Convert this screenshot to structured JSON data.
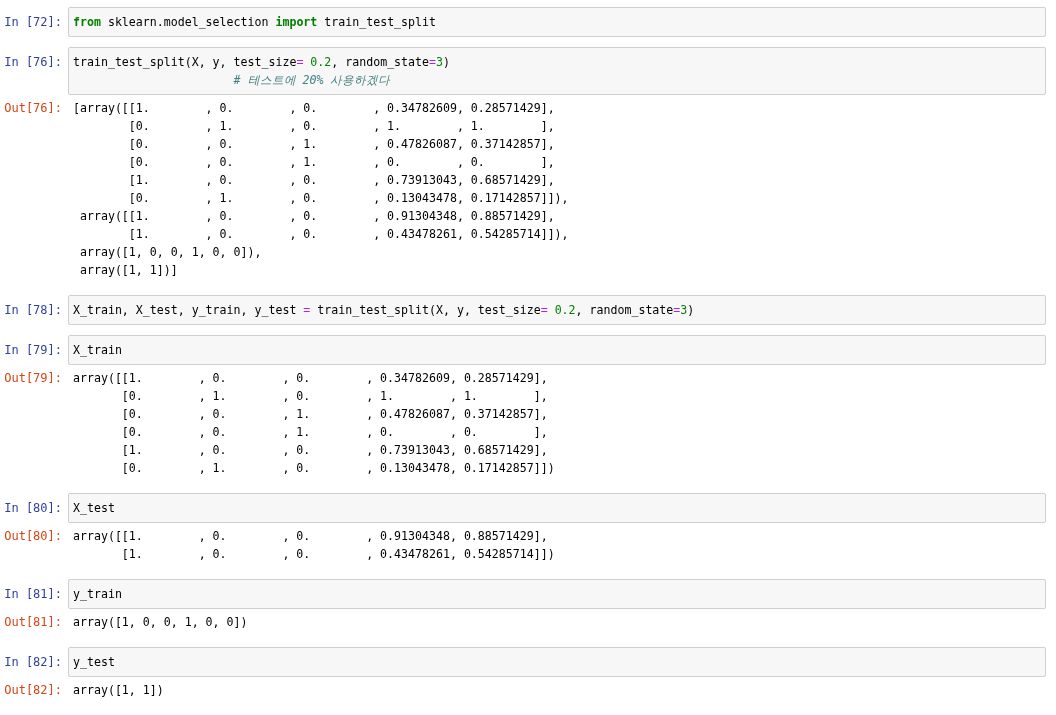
{
  "cells": [
    {
      "input_prompt": "In [72]:",
      "code": [
        [
          {
            "kind": "keyword",
            "text": "from"
          },
          {
            "kind": "name",
            "text": " sklearn.model_selection "
          },
          {
            "kind": "keyword",
            "text": "import"
          },
          {
            "kind": "name",
            "text": " train_test_split"
          }
        ]
      ]
    },
    {
      "input_prompt": "In [76]:",
      "code": [
        [
          {
            "kind": "name",
            "text": "train_test_split(X, y, test_size"
          },
          {
            "kind": "operator",
            "text": "= "
          },
          {
            "kind": "number",
            "text": "0.2"
          },
          {
            "kind": "name",
            "text": ", random_state"
          },
          {
            "kind": "operator",
            "text": "="
          },
          {
            "kind": "number",
            "text": "3"
          },
          {
            "kind": "name",
            "text": ")"
          }
        ],
        [
          {
            "kind": "comment",
            "text": "                       # 테스트에 20% 사용하겠다"
          }
        ]
      ],
      "output_prompt": "Out[76]:",
      "output": [
        "[array([[1.        , 0.        , 0.        , 0.34782609, 0.28571429],",
        "        [0.        , 1.        , 0.        , 1.        , 1.        ],",
        "        [0.        , 0.        , 1.        , 0.47826087, 0.37142857],",
        "        [0.        , 0.        , 1.        , 0.        , 0.        ],",
        "        [1.        , 0.        , 0.        , 0.73913043, 0.68571429],",
        "        [0.        , 1.        , 0.        , 0.13043478, 0.17142857]]),",
        " array([[1.        , 0.        , 0.        , 0.91304348, 0.88571429],",
        "        [1.        , 0.        , 0.        , 0.43478261, 0.54285714]]),",
        " array([1, 0, 0, 1, 0, 0]),",
        " array([1, 1])]"
      ]
    },
    {
      "input_prompt": "In [78]:",
      "code": [
        [
          {
            "kind": "name",
            "text": "X_train, X_test, y_train, y_test "
          },
          {
            "kind": "operator",
            "text": "="
          },
          {
            "kind": "name",
            "text": " train_test_split(X, y, test_size"
          },
          {
            "kind": "operator",
            "text": "= "
          },
          {
            "kind": "number",
            "text": "0.2"
          },
          {
            "kind": "name",
            "text": ", random_state"
          },
          {
            "kind": "operator",
            "text": "="
          },
          {
            "kind": "number",
            "text": "3"
          },
          {
            "kind": "name",
            "text": ")"
          }
        ]
      ]
    },
    {
      "input_prompt": "In [79]:",
      "code": [
        [
          {
            "kind": "name",
            "text": "X_train"
          }
        ]
      ],
      "output_prompt": "Out[79]:",
      "output": [
        "array([[1.        , 0.        , 0.        , 0.34782609, 0.28571429],",
        "       [0.        , 1.        , 0.        , 1.        , 1.        ],",
        "       [0.        , 0.        , 1.        , 0.47826087, 0.37142857],",
        "       [0.        , 0.        , 1.        , 0.        , 0.        ],",
        "       [1.        , 0.        , 0.        , 0.73913043, 0.68571429],",
        "       [0.        , 1.        , 0.        , 0.13043478, 0.17142857]])"
      ]
    },
    {
      "input_prompt": "In [80]:",
      "code": [
        [
          {
            "kind": "name",
            "text": "X_test"
          }
        ]
      ],
      "output_prompt": "Out[80]:",
      "output": [
        "array([[1.        , 0.        , 0.        , 0.91304348, 0.88571429],",
        "       [1.        , 0.        , 0.        , 0.43478261, 0.54285714]])"
      ]
    },
    {
      "input_prompt": "In [81]:",
      "code": [
        [
          {
            "kind": "name",
            "text": "y_train"
          }
        ]
      ],
      "output_prompt": "Out[81]:",
      "output": [
        "array([1, 0, 0, 1, 0, 0])"
      ]
    },
    {
      "input_prompt": "In [82]:",
      "code": [
        [
          {
            "kind": "name",
            "text": "y_test"
          }
        ]
      ],
      "output_prompt": "Out[82]:",
      "output": [
        "array([1, 1])"
      ]
    }
  ]
}
